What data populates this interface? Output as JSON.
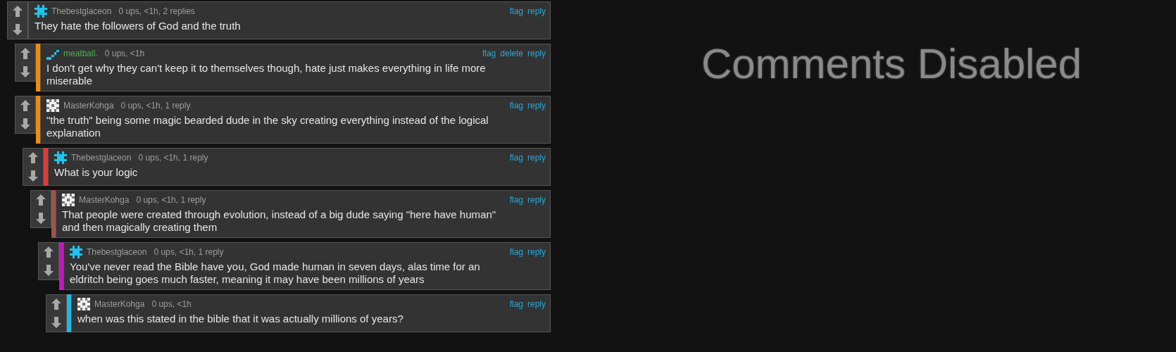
{
  "thread": [
    {
      "author": "Thebestglaceon",
      "avatar": {
        "kind": "burst"
      },
      "own": false,
      "meta": "0 ups, <1h, 2 replies",
      "actions": [
        "flag",
        "reply"
      ],
      "text": "They hate the followers of God and the truth",
      "children": [
        {
          "author": "meatball.",
          "avatar": {
            "kind": "dots"
          },
          "own": true,
          "color": "#f28a0f",
          "meta": "0 ups, <1h",
          "actions": [
            "flag",
            "delete",
            "reply"
          ],
          "text": "I don't get why they can't keep it to themselves though, hate just makes everything in life more miserable"
        },
        {
          "author": "MasterKohga",
          "avatar": {
            "kind": "checker"
          },
          "own": false,
          "color": "#f28a0f",
          "meta": "0 ups, <1h, 1 reply",
          "actions": [
            "flag",
            "reply"
          ],
          "text": "\"the truth\" being some magic bearded dude in the sky creating everything instead of the logical explanation",
          "children": [
            {
              "author": "Thebestglaceon",
              "avatar": {
                "kind": "burst"
              },
              "own": false,
              "color": "#e53935",
              "meta": "0 ups, <1h, 1 reply",
              "actions": [
                "flag",
                "reply"
              ],
              "text": "What is your logic",
              "children": [
                {
                  "author": "MasterKohga",
                  "avatar": {
                    "kind": "checker"
                  },
                  "own": false,
                  "color": "#a0524d",
                  "meta": "0 ups, <1h, 1 reply",
                  "actions": [
                    "flag",
                    "reply"
                  ],
                  "text": "That people were created through evolution, instead of a big dude saying \"here have human\" and then magically creating them",
                  "children": [
                    {
                      "author": "Thebestglaceon",
                      "avatar": {
                        "kind": "burst"
                      },
                      "own": false,
                      "color": "#c218c2",
                      "meta": "0 ups, <1h, 1 reply",
                      "actions": [
                        "flag",
                        "reply"
                      ],
                      "text": "You've never read the Bible have you, God made human in seven days, alas time for an eldritch being goes much faster, meaning it may have been millions of years",
                      "children": [
                        {
                          "author": "MasterKohga",
                          "avatar": {
                            "kind": "checker"
                          },
                          "own": false,
                          "color": "#1fb7e6",
                          "meta": "0 ups, <1h",
                          "actions": [
                            "flag",
                            "reply"
                          ],
                          "text": "when was this stated in the bible that it was actually millions of years?"
                        }
                      ]
                    }
                  ]
                }
              ]
            }
          ]
        }
      ]
    }
  ],
  "disabled_notice": "Comments Disabled"
}
